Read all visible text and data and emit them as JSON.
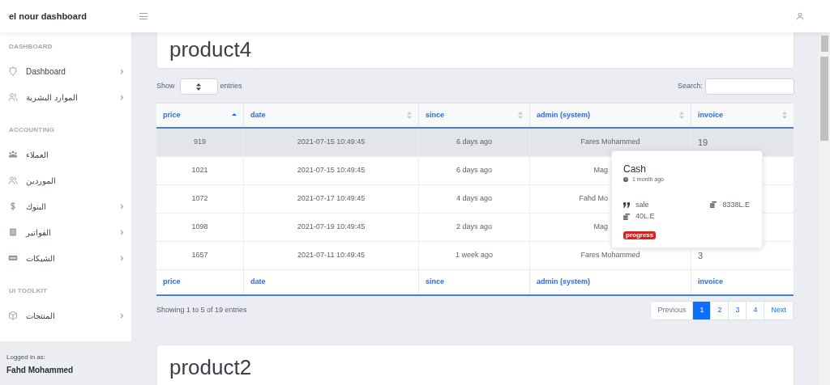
{
  "brand": "el nour dashboard",
  "sidebar": {
    "sections": [
      {
        "title": "DASHBOARD",
        "items": [
          {
            "label": "Dashboard",
            "has_children": true
          },
          {
            "label": "الموارد البشرية",
            "has_children": true
          }
        ]
      },
      {
        "title": "ACCOUNTING",
        "items": [
          {
            "label": "العملاء",
            "has_children": false
          },
          {
            "label": "الموردين",
            "has_children": false
          },
          {
            "label": "البنوك",
            "has_children": true
          },
          {
            "label": "الفواتير",
            "has_children": true
          },
          {
            "label": "الشيكات",
            "has_children": true
          }
        ]
      },
      {
        "title": "UI TOOLKIT",
        "items": [
          {
            "label": "المنتجات",
            "has_children": true
          }
        ]
      }
    ],
    "logged_in_label": "Logged in as:",
    "user": "Fahd Mohammed"
  },
  "panel_title": "product4",
  "show_label": "Show",
  "entries_label": "entries",
  "search_label": "Search:",
  "table": {
    "columns": [
      {
        "label": "price",
        "sorted": true
      },
      {
        "label": "date",
        "sorted": false
      },
      {
        "label": "since",
        "sorted": false
      },
      {
        "label": "admin (system)",
        "sorted": false
      },
      {
        "label": "invoice",
        "sorted": false
      }
    ],
    "rows": [
      {
        "cells": [
          "919",
          "2021-07-15 10:49:45",
          "6 days ago",
          "Fares Mohammed",
          "19"
        ],
        "selected": true
      },
      {
        "cells": [
          "1021",
          "2021-07-15 10:49:45",
          "6 days ago",
          "Mag"
        ],
        "selected": false
      },
      {
        "cells": [
          "1072",
          "2021-07-17 10:49:45",
          "4 days ago",
          "Fahd Mo"
        ],
        "selected": false
      },
      {
        "cells": [
          "1098",
          "2021-07-19 10:49:45",
          "2 days ago",
          "Mag"
        ],
        "selected": false
      },
      {
        "cells": [
          "1657",
          "2021-07-11 10:49:45",
          "1 week ago",
          "Fares Mohammed",
          "3"
        ],
        "selected": false
      }
    ],
    "footer": [
      "price",
      "date",
      "since",
      "admin (system)",
      "invoice"
    ]
  },
  "popover": {
    "title": "Cash",
    "time": "1 month ago",
    "type": "sale",
    "amount": "8338L.E",
    "paid": "40L.E",
    "badge": "progress"
  },
  "info": "Showing 1 to 5 of 19 entries",
  "pagination": [
    {
      "label": "Previous",
      "selected": false
    },
    {
      "label": "1",
      "selected": true
    },
    {
      "label": "2",
      "selected": false
    },
    {
      "label": "3",
      "selected": false
    },
    {
      "label": "4",
      "selected": false
    },
    {
      "label": "Next",
      "selected": false
    }
  ],
  "next_panel_title": "product2"
}
